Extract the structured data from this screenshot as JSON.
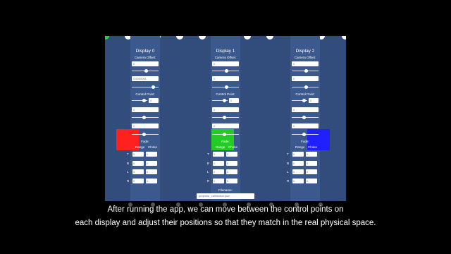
{
  "colors": {
    "app_bg": "#324c7c",
    "column_bg": "#3c598e",
    "swatches": [
      "#ff2020",
      "#22cc22",
      "#2020ff"
    ]
  },
  "displays": [
    {
      "title": "Display 0",
      "camera_offset_label": "Camera Offset:",
      "offset_values": [
        "0",
        "0.6000061",
        "0"
      ],
      "control_point_label": "Control Point:",
      "control_point_value": "0",
      "cp_values": [
        "0",
        "0"
      ],
      "fade_label": "Fade:",
      "range_label": "Range",
      "choke_label": "Choke",
      "fade_rows": [
        {
          "side": "T",
          "range": "0",
          "choke": "0"
        },
        {
          "side": "B",
          "range": "0",
          "choke": "0"
        },
        {
          "side": "L",
          "range": "0",
          "choke": "0"
        },
        {
          "side": "R",
          "range": "0",
          "choke": "0"
        }
      ],
      "swatch_color": "red"
    },
    {
      "title": "Display 1",
      "camera_offset_label": "Camera Offset:",
      "offset_values": [
        "0",
        "0",
        "0"
      ],
      "control_point_label": "Control Point:",
      "control_point_value": "0",
      "cp_values": [
        "0",
        "0"
      ],
      "fade_label": "Fade:",
      "range_label": "Range",
      "choke_label": "Choke",
      "fade_rows": [
        {
          "side": "T",
          "range": "0",
          "choke": "0"
        },
        {
          "side": "B",
          "range": "0",
          "choke": "0"
        },
        {
          "side": "L",
          "range": "0",
          "choke": "0"
        },
        {
          "side": "R",
          "range": "0",
          "choke": "0"
        }
      ],
      "swatch_color": "green"
    },
    {
      "title": "Display 2",
      "camera_offset_label": "Camera Offset:",
      "offset_values": [
        "0",
        "0",
        "0"
      ],
      "control_point_label": "Control Point:",
      "control_point_value": "0",
      "cp_values": [
        "0",
        "0"
      ],
      "fade_label": "Fade:",
      "range_label": "Range",
      "choke_label": "Choke",
      "fade_rows": [
        {
          "side": "T",
          "range": "0",
          "choke": "0"
        },
        {
          "side": "B",
          "range": "0",
          "choke": "0"
        },
        {
          "side": "L",
          "range": "0",
          "choke": "0"
        },
        {
          "side": "R",
          "range": "0",
          "choke": "0"
        }
      ],
      "swatch_color": "blue"
    }
  ],
  "filename": {
    "label": "Filename:",
    "value": "projector_calibration.json"
  },
  "caption": {
    "line1": "After running the app, we can move between the control points on",
    "line2": "each display and adjust their positions so that they match in the real physical space."
  }
}
